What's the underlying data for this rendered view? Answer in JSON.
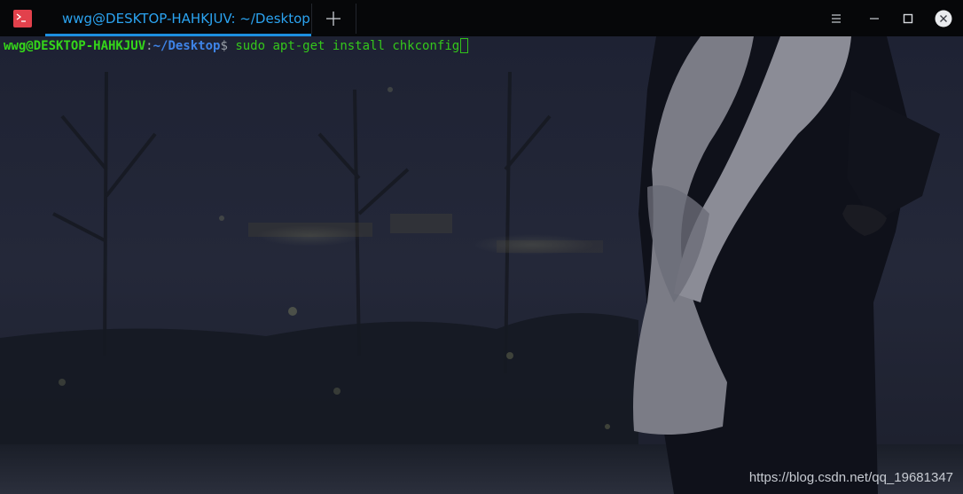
{
  "titlebar": {
    "app_icon": "terminal-icon",
    "tab_title": "wwg@DESKTOP-HAHKJUV: ~/Desktop",
    "new_tab_icon": "plus-icon",
    "controls": [
      "menu-icon",
      "minimize-icon",
      "maximize-icon",
      "close-icon"
    ]
  },
  "terminal": {
    "user_host": "wwg@DESKTOP-HAHKJUV",
    "separator": ":",
    "path": "~/Desktop",
    "prompt_symbol": "$",
    "command": " sudo apt-get install chkconfig"
  },
  "watermark": "https://blog.csdn.net/qq_19681347",
  "colors": {
    "tab_accent": "#1d8fe0",
    "app_icon_bg": "#e2414c",
    "prompt_user": "#35d61a",
    "prompt_path": "#3e84e8",
    "command_text": "#34c71b"
  }
}
